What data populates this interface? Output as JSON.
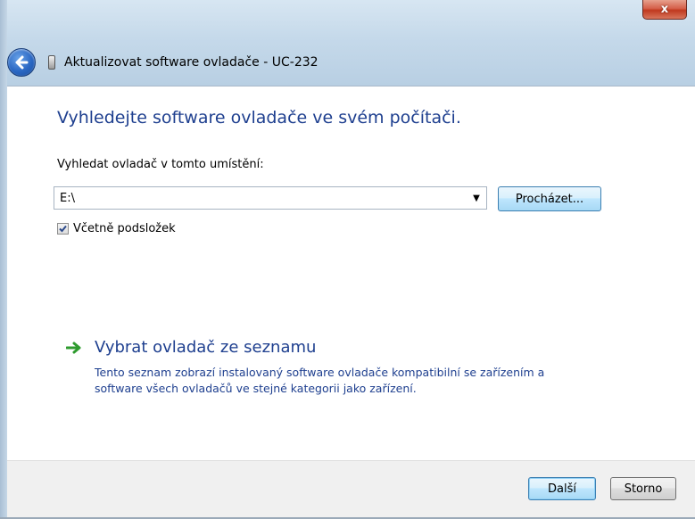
{
  "window": {
    "title": "Aktualizovat software ovladače - UC-232",
    "close_symbol": "x",
    "close_icon": "close-icon",
    "back_icon": "back-arrow-icon",
    "device_icon": "usb-device-icon"
  },
  "content": {
    "heading": "Vyhledejte software ovladače ve svém počítači.",
    "search_label": "Vyhledat ovladač v tomto umístění:",
    "location_value": "E:\\",
    "dropdown_icon": "chevron-down-icon",
    "browse_button": "Procházet...",
    "include_subfolders": {
      "label": "Včetně podsložek",
      "checked": true
    },
    "pick_option": {
      "title": "Vybrat ovladač ze seznamu",
      "description": "Tento seznam zobrazí instalovaný software ovladače kompatibilní se zařízením a software všech ovladačů ve stejné kategorii jako zařízení.",
      "icon": "green-arrow-icon"
    }
  },
  "footer": {
    "next_button": "Další",
    "cancel_button": "Storno"
  },
  "colors": {
    "heading_blue": "#1e3f8f",
    "close_red": "#c0391f",
    "arrow_green": "#2e9b2e"
  }
}
